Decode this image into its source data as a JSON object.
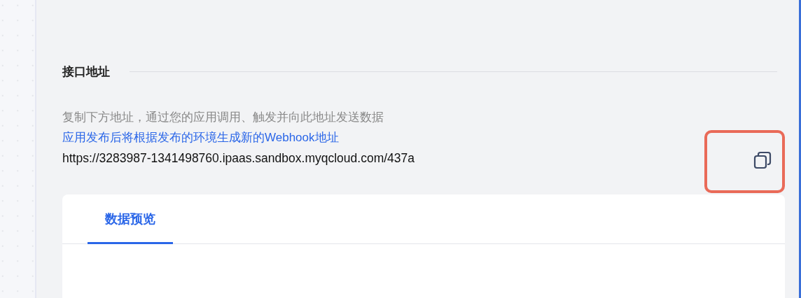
{
  "section": {
    "title": "接口地址",
    "description": "复制下方地址，通过您的应用调用、触发并向此地址发送数据",
    "notice": "应用发布后将根据发布的环境生成新的Webhook地址",
    "url": "https://3283987-1341498760.ipaas.sandbox.myqcloud.com/437a"
  },
  "tabs": [
    {
      "label": "数据预览",
      "selected": true
    }
  ]
}
